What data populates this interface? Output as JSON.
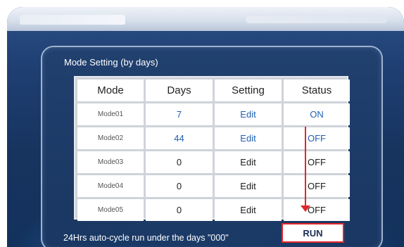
{
  "panel": {
    "title": "Mode Setting (by days)",
    "table": {
      "headers": [
        "Mode",
        "Days",
        "Setting",
        "Status"
      ],
      "rows": [
        {
          "mode": "Mode01",
          "days": "7",
          "setting": "Edit",
          "status": "ON"
        },
        {
          "mode": "Mode02",
          "days": "44",
          "setting": "Edit",
          "status": "OFF"
        },
        {
          "mode": "Mode03",
          "days": "0",
          "setting": "Edit",
          "status": "OFF"
        },
        {
          "mode": "Mode04",
          "days": "0",
          "setting": "Edit",
          "status": "OFF"
        },
        {
          "mode": "Mode05",
          "days": "0",
          "setting": "Edit",
          "status": "OFF"
        }
      ]
    },
    "footer_text": "24Hrs auto-cycle run under the days \"000\"",
    "run_label": "RUN"
  },
  "colors": {
    "accent_blue": "#1f5fb3",
    "highlight_red": "#e0262a",
    "background": "#17345f"
  }
}
